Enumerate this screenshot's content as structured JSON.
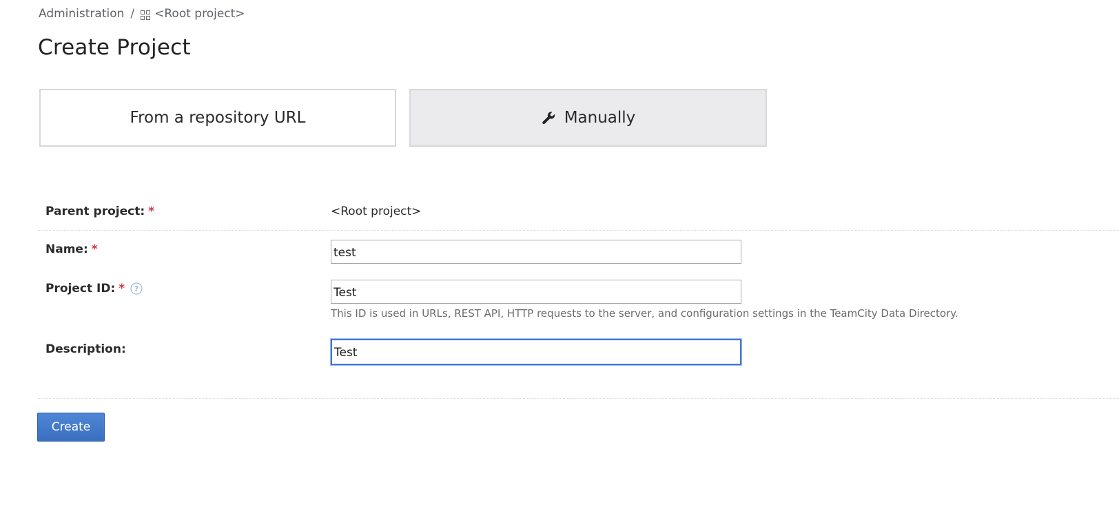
{
  "breadcrumb": {
    "administration": "Administration",
    "separator": "/",
    "root_project": "<Root project>"
  },
  "page_title": "Create Project",
  "modes": {
    "repository": "From a repository URL",
    "manual": "Manually",
    "selected": "manual"
  },
  "form": {
    "parent_project": {
      "label": "Parent project:",
      "required": "*",
      "value": "<Root project>"
    },
    "name": {
      "label": "Name:",
      "required": "*",
      "value": "test"
    },
    "project_id": {
      "label": "Project ID:",
      "required": "*",
      "value": "Test",
      "hint": "This ID is used in URLs, REST API, HTTP requests to the server, and configuration settings in the TeamCity Data Directory."
    },
    "description": {
      "label": "Description:",
      "value": "Test"
    }
  },
  "actions": {
    "create_label": "Create"
  },
  "colors": {
    "accent": "#3b78d4",
    "required": "#d0394b",
    "selected_card_bg": "#ebebed",
    "button_bg": "#4a7fd0"
  },
  "icons": {
    "breadcrumb": "grid-icon",
    "manual_mode": "wrench-icon",
    "project_id_help": "help-icon"
  }
}
